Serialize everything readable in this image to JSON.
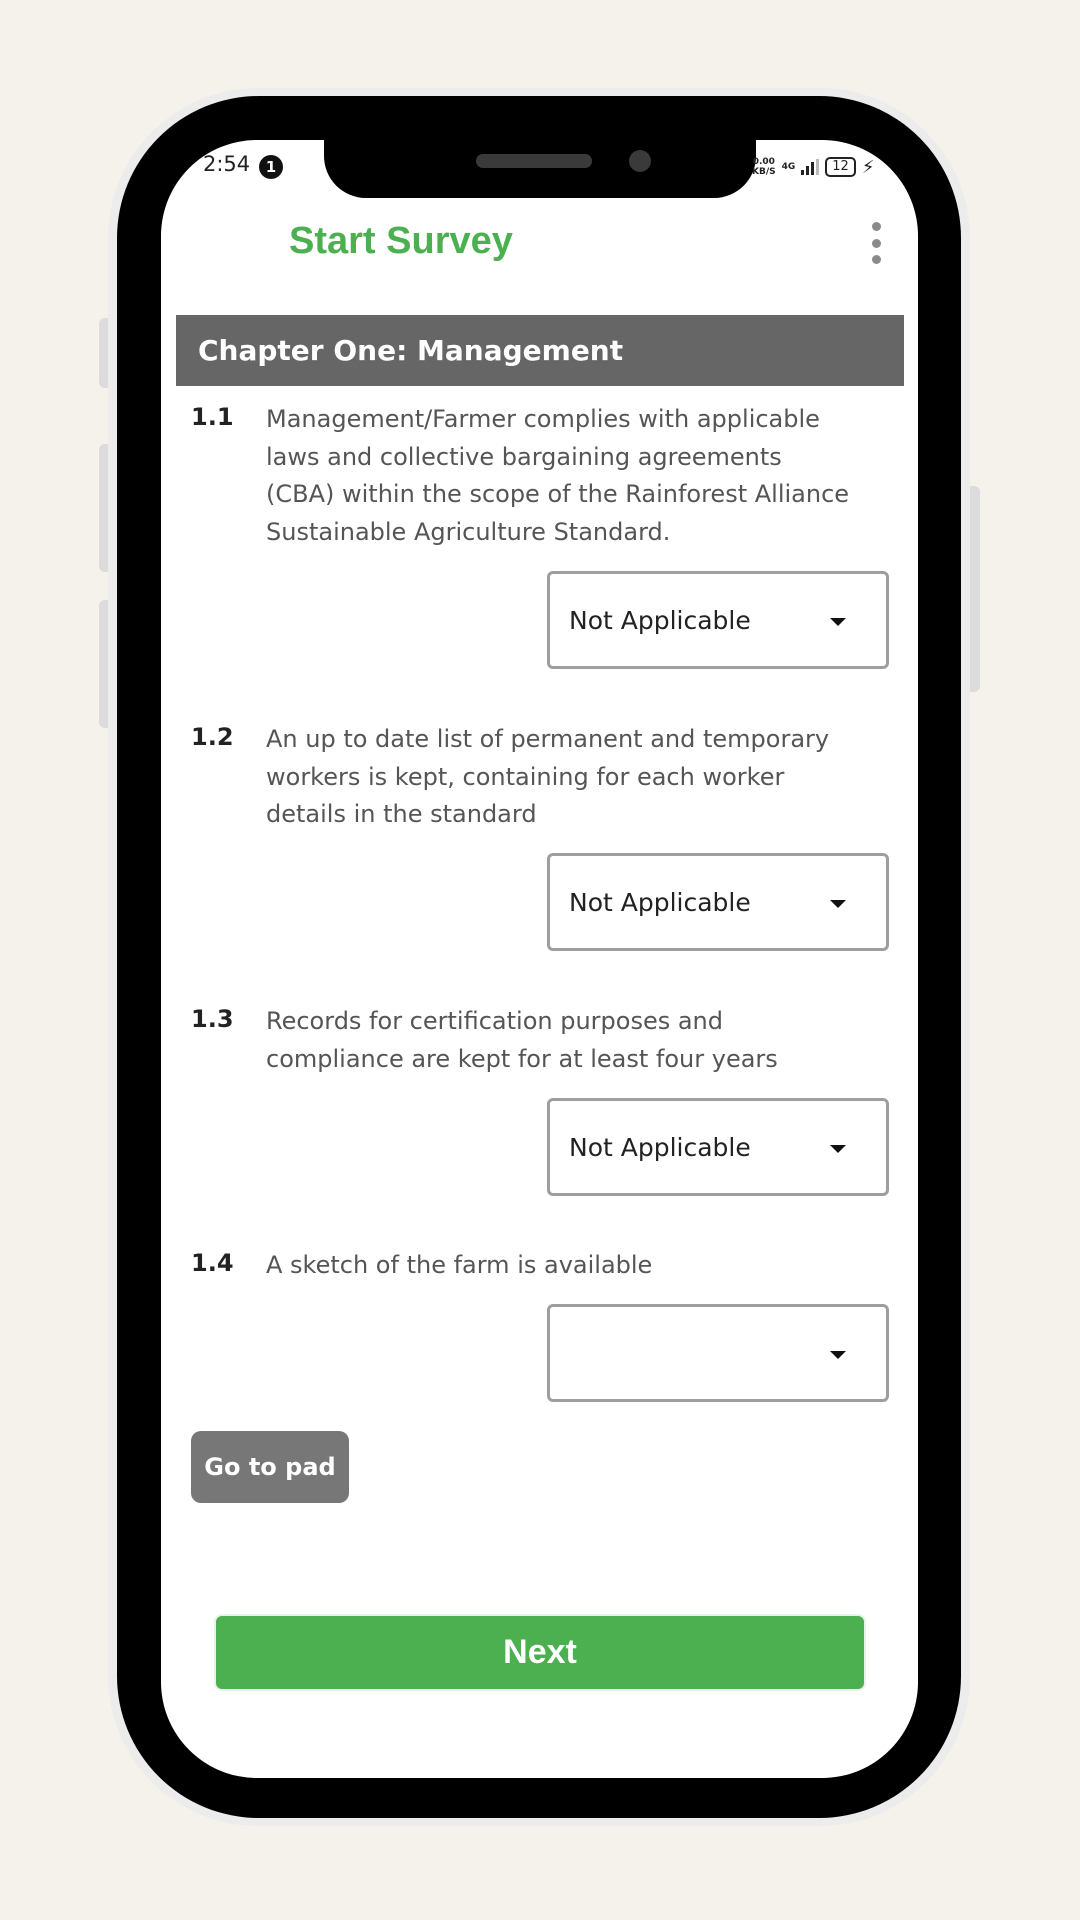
{
  "status_bar": {
    "time": "2:54",
    "notification_count": "1",
    "net_speed_value": "0.00",
    "net_speed_unit": "KB/S",
    "network_type": "4G",
    "battery": "12"
  },
  "app_bar": {
    "title": "Start Survey"
  },
  "chapter": {
    "title": "Chapter One: Management"
  },
  "questions": [
    {
      "number": "1.1",
      "text": "Management/Farmer complies with applicable laws and collective bargaining agreements (CBA) within the scope of the Rainforest Alliance Sustainable Agriculture Standard.",
      "selected": "Not Applicable"
    },
    {
      "number": "1.2",
      "text": "An up to date list of permanent and temporary workers is kept, containing for each worker details in the standard",
      "selected": "Not Applicable"
    },
    {
      "number": "1.3",
      "text": "Records for certification purposes and compliance are kept for at least four years",
      "selected": "Not Applicable"
    },
    {
      "number": "1.4",
      "text": "A sketch of the farm is available",
      "selected": ""
    }
  ],
  "actions": {
    "pad_label": "Go to pad",
    "next_label": "Next"
  },
  "colors": {
    "brand_green": "#4caf50",
    "chapter_header": "#666666",
    "pad_button": "#777777"
  }
}
